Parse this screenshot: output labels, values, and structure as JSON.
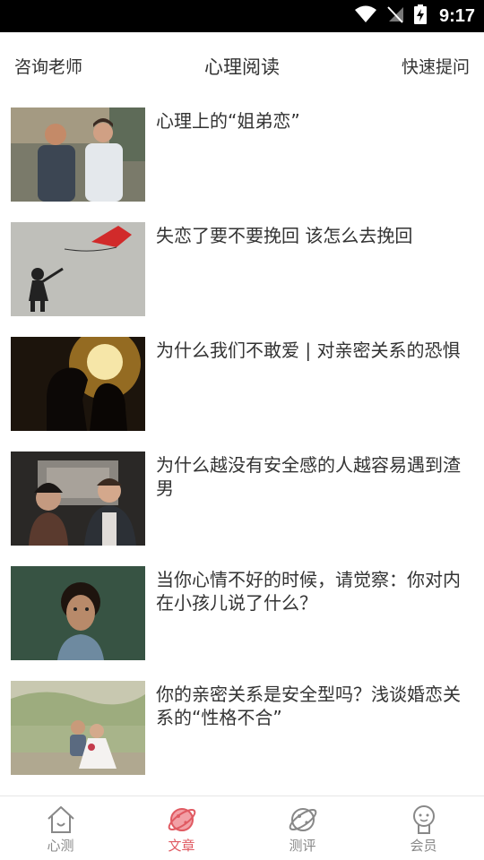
{
  "status_bar": {
    "time": "9:17"
  },
  "header": {
    "left_label": "咨询老师",
    "title": "心理阅读",
    "right_label": "快速提问"
  },
  "articles": [
    {
      "title": "心理上的“姐弟恋”"
    },
    {
      "title": "失恋了要不要挽回 该怎么去挽回"
    },
    {
      "title": "为什么我们不敢爱 | 对亲密关系的恐惧"
    },
    {
      "title": "为什么越没有安全感的人越容易遇到渣男"
    },
    {
      "title": "当你心情不好的时候，请觉察：你对内在小孩儿说了什么？"
    },
    {
      "title": "你的亲密关系是安全型吗？浅谈婚恋关系的“性格不合”"
    }
  ],
  "tabs": [
    {
      "label": "心测",
      "icon": "house-icon",
      "active": false
    },
    {
      "label": "文章",
      "icon": "planet-icon",
      "active": true
    },
    {
      "label": "测评",
      "icon": "planet-icon",
      "active": false
    },
    {
      "label": "会员",
      "icon": "person-icon",
      "active": false
    }
  ],
  "colors": {
    "accent": "#e05a62",
    "inactive": "#888888"
  }
}
